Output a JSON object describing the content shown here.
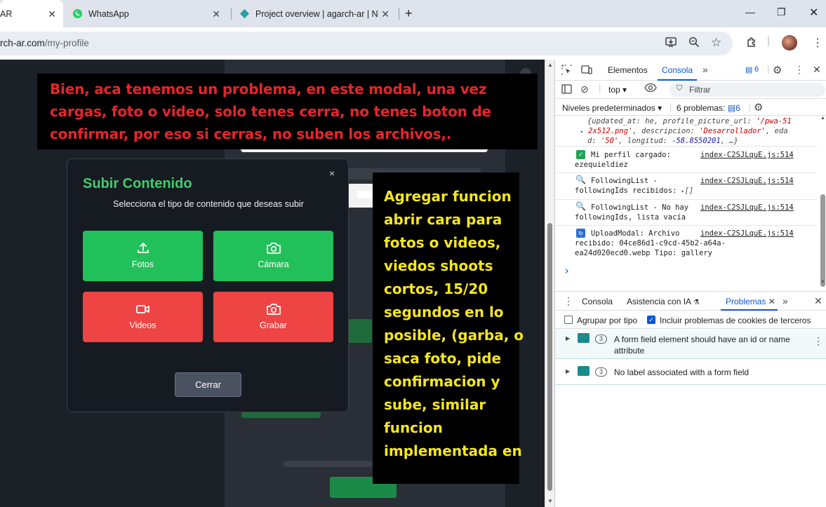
{
  "browser": {
    "tabs": [
      {
        "title": "AR",
        "icon": "globe-icon"
      },
      {
        "title": "WhatsApp",
        "icon": "whatsapp-icon"
      },
      {
        "title": "Project overview | agarch-ar | N",
        "icon": "diamond-icon"
      }
    ],
    "new_tab": "+",
    "url_host": "rch-ar.com",
    "url_path": "/my-profile"
  },
  "annotations": {
    "top_note": [
      "Bien, aca tenemos un problema, en este modal, una vez",
      "cargas, foto o video, solo tenes cerra, no tenes boton de",
      "confirmar, por eso si cerras, no suben los archivos,."
    ],
    "side_note": [
      "Agregar funcion",
      "abrir cara para",
      "fotos o videos,",
      "viedos shoots",
      "cortos, 15/20",
      "segundos en lo",
      "posible, (garba, o",
      "saca foto, pide",
      "confirmacion y",
      "sube, similar",
      "funcion",
      "implementada en"
    ]
  },
  "modal": {
    "title": "Subir Contenido",
    "subtitle": "Selecciona el tipo de contenido que deseas subir",
    "close_icon": "×",
    "options": [
      {
        "label": "Fotos",
        "icon": "upload-icon"
      },
      {
        "label": "Cámara",
        "icon": "camera-icon"
      },
      {
        "label": "Videos",
        "icon": "video-icon"
      },
      {
        "label": "Grabar",
        "icon": "camera-icon"
      }
    ],
    "close_button": "Cerrar",
    "colors": {
      "green": "#22c05a",
      "red": "#ef4444",
      "title": "#3fcf6d"
    }
  },
  "devtools": {
    "tabs": [
      "Elementos",
      "Consola"
    ],
    "active_tab": "Consola",
    "issue_badge": "6",
    "context": "top",
    "filter_placeholder": "Filtrar",
    "levels": "Niveles predeterminados",
    "problems_count": "6 problemas:",
    "problems_badge": "6",
    "console_lines": {
      "obj_line1_a": "{updated_at: he, profile_picture_url: ",
      "obj_line1_b": "'/pwa-51",
      "obj_line2_a": "2x512.png'",
      "obj_line2_b": ", descripcion: ",
      "obj_line2_c": "'Desarrollador'",
      "obj_line2_d": ", eda",
      "obj_line3_a": "d: ",
      "obj_line3_b": "'50'",
      "obj_line3_c": ", longitud: ",
      "obj_line3_d": "-58.8550201",
      "obj_line3_e": ", …}"
    },
    "messages": [
      {
        "icon": "check-icon",
        "line1": "Mi perfil cargado:",
        "line2": "ezequieldiez",
        "source": "index-C2SJLquE.js:514"
      },
      {
        "icon": "magnifier-icon",
        "line1": "FollowingList -",
        "line2": "followingIds recibidos:",
        "extra": "[]",
        "source": "index-C2SJLquE.js:514"
      },
      {
        "icon": "magnifier-icon",
        "line1": "FollowingList - No hay",
        "line2": "followingIds, lista vacía",
        "source": "index-C2SJLquE.js:514"
      },
      {
        "icon": "refresh-icon",
        "line1": "UploadModal: Archivo",
        "line2": "recibido: 04ce86d1-c9cd-45b2-a64a-",
        "line3": "ea24d020ecd0.webp Tipo: gallery",
        "source": "index-C2SJLquE.js:514"
      }
    ],
    "prompt": "›",
    "drawer_tabs": [
      "Consola",
      "Asistencia con IA",
      "Problemas"
    ],
    "drawer_active": "Problemas",
    "group_by_type": "Agrupar por tipo",
    "third_party": "Incluir problemas de cookies de terceros",
    "issues": [
      {
        "count": "3",
        "text_line1": "A form field element should have an id or name",
        "text_line2": "attribute"
      },
      {
        "count": "3",
        "text_line1": "No label associated with a form field",
        "text_line2": ""
      }
    ]
  }
}
